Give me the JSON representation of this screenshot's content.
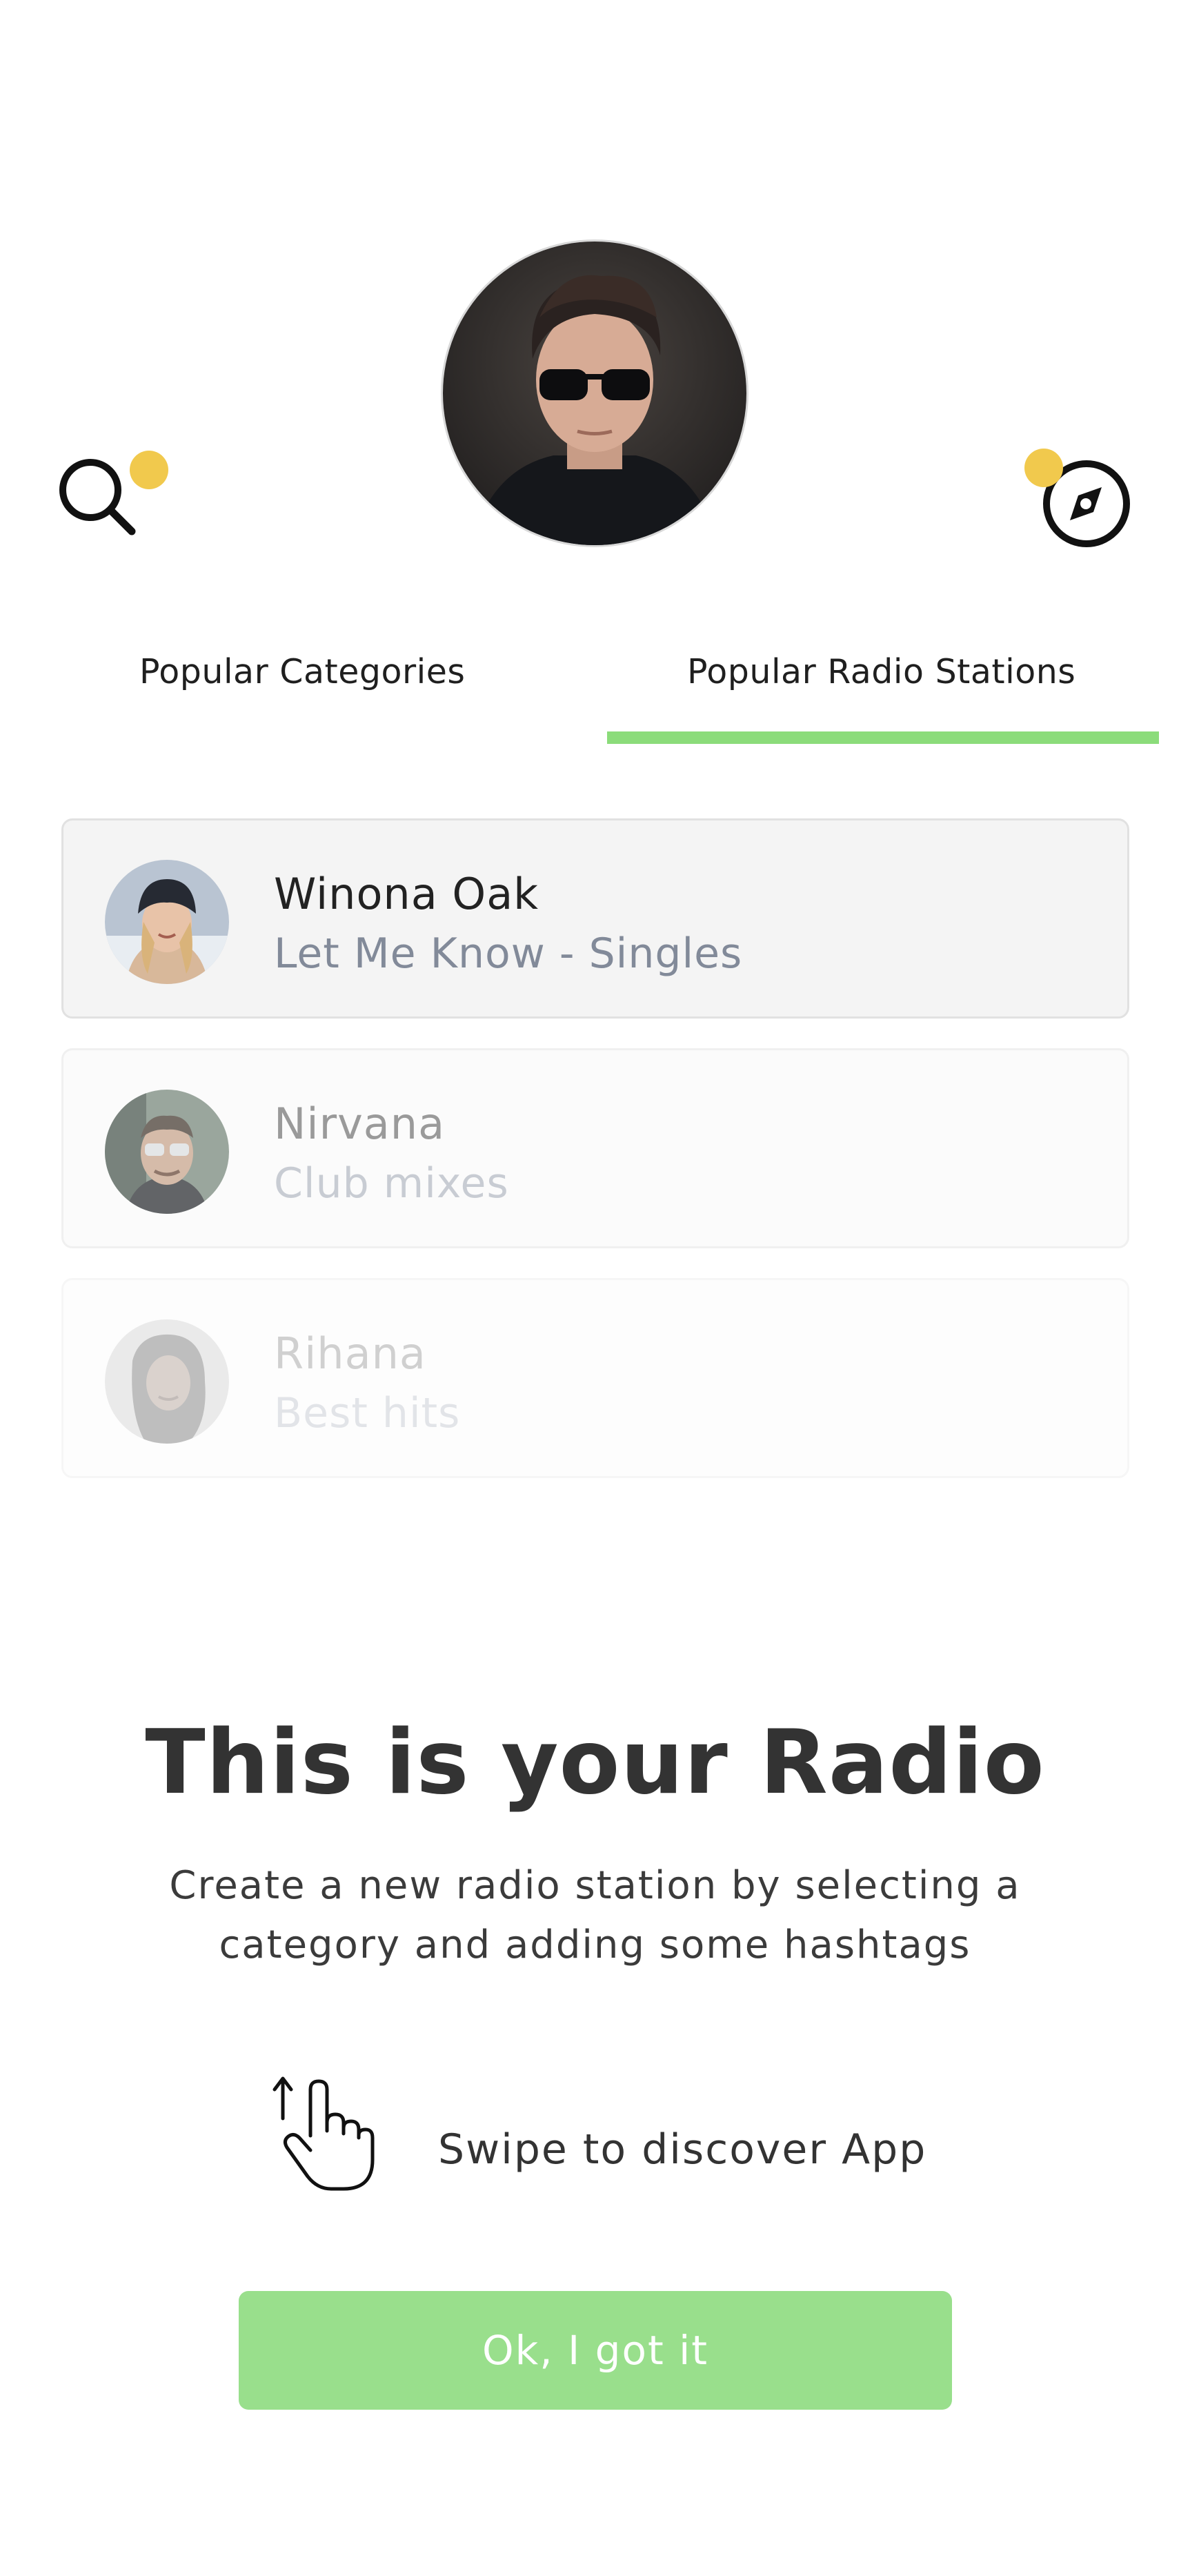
{
  "header": {
    "profile_avatar": "user-profile-photo",
    "search_icon": "search-icon",
    "compass_icon": "compass-icon",
    "accent_color": "#f1c94d"
  },
  "tabs": [
    {
      "label": "Popular Categories",
      "active": false
    },
    {
      "label": "Popular Radio Stations",
      "active": true
    }
  ],
  "tab_indicator_color": "#8bdc7a",
  "stations": [
    {
      "title": "Winona Oak",
      "subtitle": "Let Me Know - Singles"
    },
    {
      "title": "Nirvana",
      "subtitle": "Club mixes"
    },
    {
      "title": "Rihana",
      "subtitle": "Best hits"
    }
  ],
  "onboarding": {
    "headline": "This is your Radio",
    "description": "Create a new radio station by selecting a category and adding some hashtags",
    "swipe_icon": "swipe-hand-icon",
    "swipe_label": "Swipe to discover App",
    "button_label": "Ok, I got it",
    "button_color": "#99df8c"
  }
}
